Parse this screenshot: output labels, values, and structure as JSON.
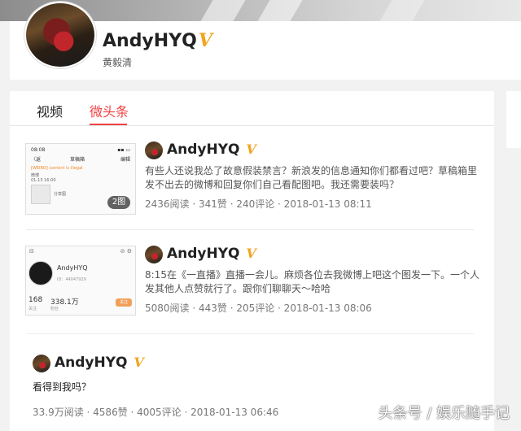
{
  "profile": {
    "name": "AndyHYQ",
    "verified_mark": "V",
    "real_name": "黄毅清"
  },
  "tabs": [
    {
      "label": "视频",
      "active": false
    },
    {
      "label": "微头条",
      "active": true
    }
  ],
  "posts": [
    {
      "author": "AndyHYQ",
      "verified_mark": "V",
      "text": "有些人还说我怂了故意假装禁言？新浪发的信息通知你们都看过吧？草稿箱里发不出去的微博和回复你们自己看配图吧。我还需要装吗？",
      "meta": "2436阅读 · 341赞 · 240评论 · 2018-01-13 08:11",
      "thumb_badge": "2图",
      "thumb": {
        "time": "08:08",
        "title": "草稿箱",
        "left": "〈返",
        "right": "编辑",
        "notice": "[WEIBO] content is illegal",
        "line1": "微博",
        "line2": "01-13 16:00",
        "share": "分享图"
      }
    },
    {
      "author": "AndyHYQ",
      "verified_mark": "V",
      "text": "8:15在《一直播》直播一会儿。麻烦各位去我微博上吧这个图发一下。一个人发其他人点赞就行了。跟你们聊聊天～哈哈",
      "meta": "5080阅读 · 443赞 · 205评论 · 2018-01-13 08:06",
      "thumb": {
        "name": "AndyHYQ",
        "id": "ID：44047929",
        "num1": "168",
        "num2": "338.1万",
        "label1": "关注",
        "label2": "粉丝",
        "button": "关注"
      }
    },
    {
      "author": "AndyHYQ",
      "verified_mark": "V",
      "text": "看得到我吗？",
      "meta": "33.9万阅读 · 4586赞 · 4005评论 · 2018-01-13 06:46"
    }
  ],
  "watermark": "头条号 / 娱乐随手记",
  "colors": {
    "accent": "#f04142",
    "verified": "#f2a31f",
    "background": "#f2f2f2"
  }
}
